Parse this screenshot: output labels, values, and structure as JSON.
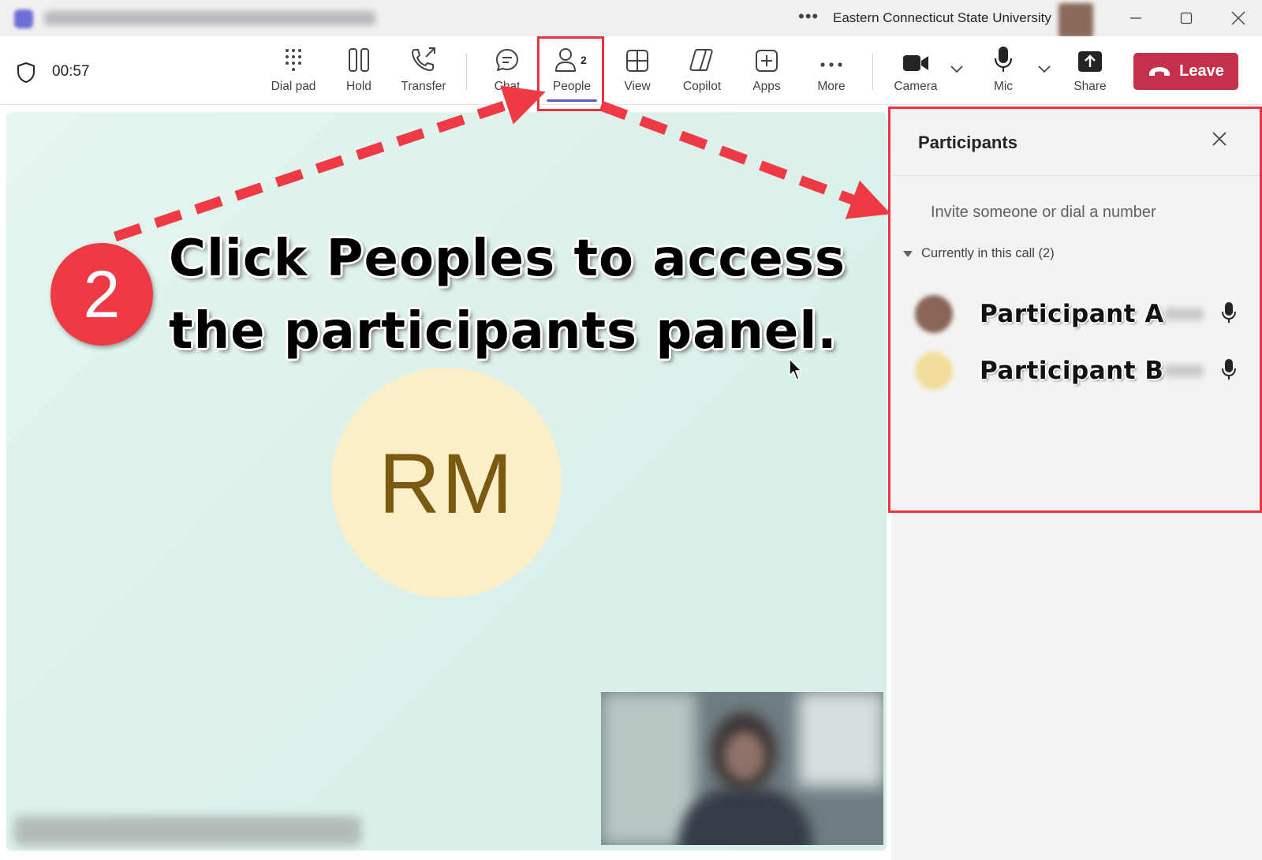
{
  "window": {
    "org_name": "Eastern Connecticut State University",
    "controls": {
      "minimize_icon": "minimize-icon",
      "maximize_icon": "maximize-icon",
      "close_icon": "close-icon"
    }
  },
  "call": {
    "elapsed": "00:57"
  },
  "toolbar": {
    "buttons": [
      {
        "label": "Dial pad",
        "icon": "dialpad-icon"
      },
      {
        "label": "Hold",
        "icon": "pause-icon"
      },
      {
        "label": "Transfer",
        "icon": "transfer-icon"
      },
      {
        "label": "Chat",
        "icon": "chat-icon"
      },
      {
        "label": "People",
        "icon": "people-icon",
        "badge": "2"
      },
      {
        "label": "View",
        "icon": "grid-icon"
      },
      {
        "label": "Copilot",
        "icon": "copilot-icon"
      },
      {
        "label": "Apps",
        "icon": "add-app-icon"
      },
      {
        "label": "More",
        "icon": "more-icon"
      },
      {
        "label": "Camera",
        "icon": "camera-icon"
      },
      {
        "label": "Mic",
        "icon": "mic-icon"
      },
      {
        "label": "Share",
        "icon": "share-icon"
      }
    ],
    "leave_label": "Leave"
  },
  "stage": {
    "avatar_initials": "RM"
  },
  "panel": {
    "title": "Participants",
    "invite_placeholder": "Invite someone or dial a number",
    "section_label": "Currently in this call (2)",
    "participants": [
      {
        "name": "Participant A",
        "avatar_color": "#8a6456"
      },
      {
        "name": "Participant B",
        "avatar_color": "#f1de9a"
      }
    ]
  },
  "annotation": {
    "step_number": "2",
    "text": "Click Peoples to access the participants panel.",
    "accent_color": "#ee3a45"
  }
}
